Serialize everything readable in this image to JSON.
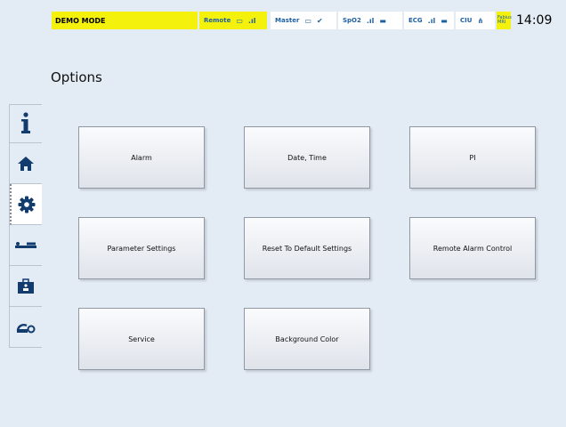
{
  "status": {
    "demo_mode": "DEMO MODE",
    "remote": "Remote",
    "master": "Master",
    "spo2": "SpO2",
    "ecg": "ECG",
    "ciu": "CIU",
    "fabius_line1": "Fabius",
    "fabius_line2": "MRI",
    "time": "14:09"
  },
  "page": {
    "title": "Options"
  },
  "sidebar": {
    "items": [
      {
        "icon": "info-icon"
      },
      {
        "icon": "home-icon"
      },
      {
        "icon": "gear-icon",
        "active": true
      },
      {
        "icon": "patient-bed-icon"
      },
      {
        "icon": "medical-case-icon"
      },
      {
        "icon": "sensor-cable-icon"
      }
    ]
  },
  "options": {
    "alarm": "Alarm",
    "date_time": "Date, Time",
    "pi": "PI",
    "parameter_settings": "Parameter Settings",
    "reset_default": "Reset To Default Settings",
    "remote_alarm": "Remote Alarm Control",
    "service": "Service",
    "background_color": "Background Color"
  },
  "colors": {
    "background": "#e3ebf4",
    "status_yellow": "#f4f10c",
    "accent_blue": "#1d5fa3"
  }
}
